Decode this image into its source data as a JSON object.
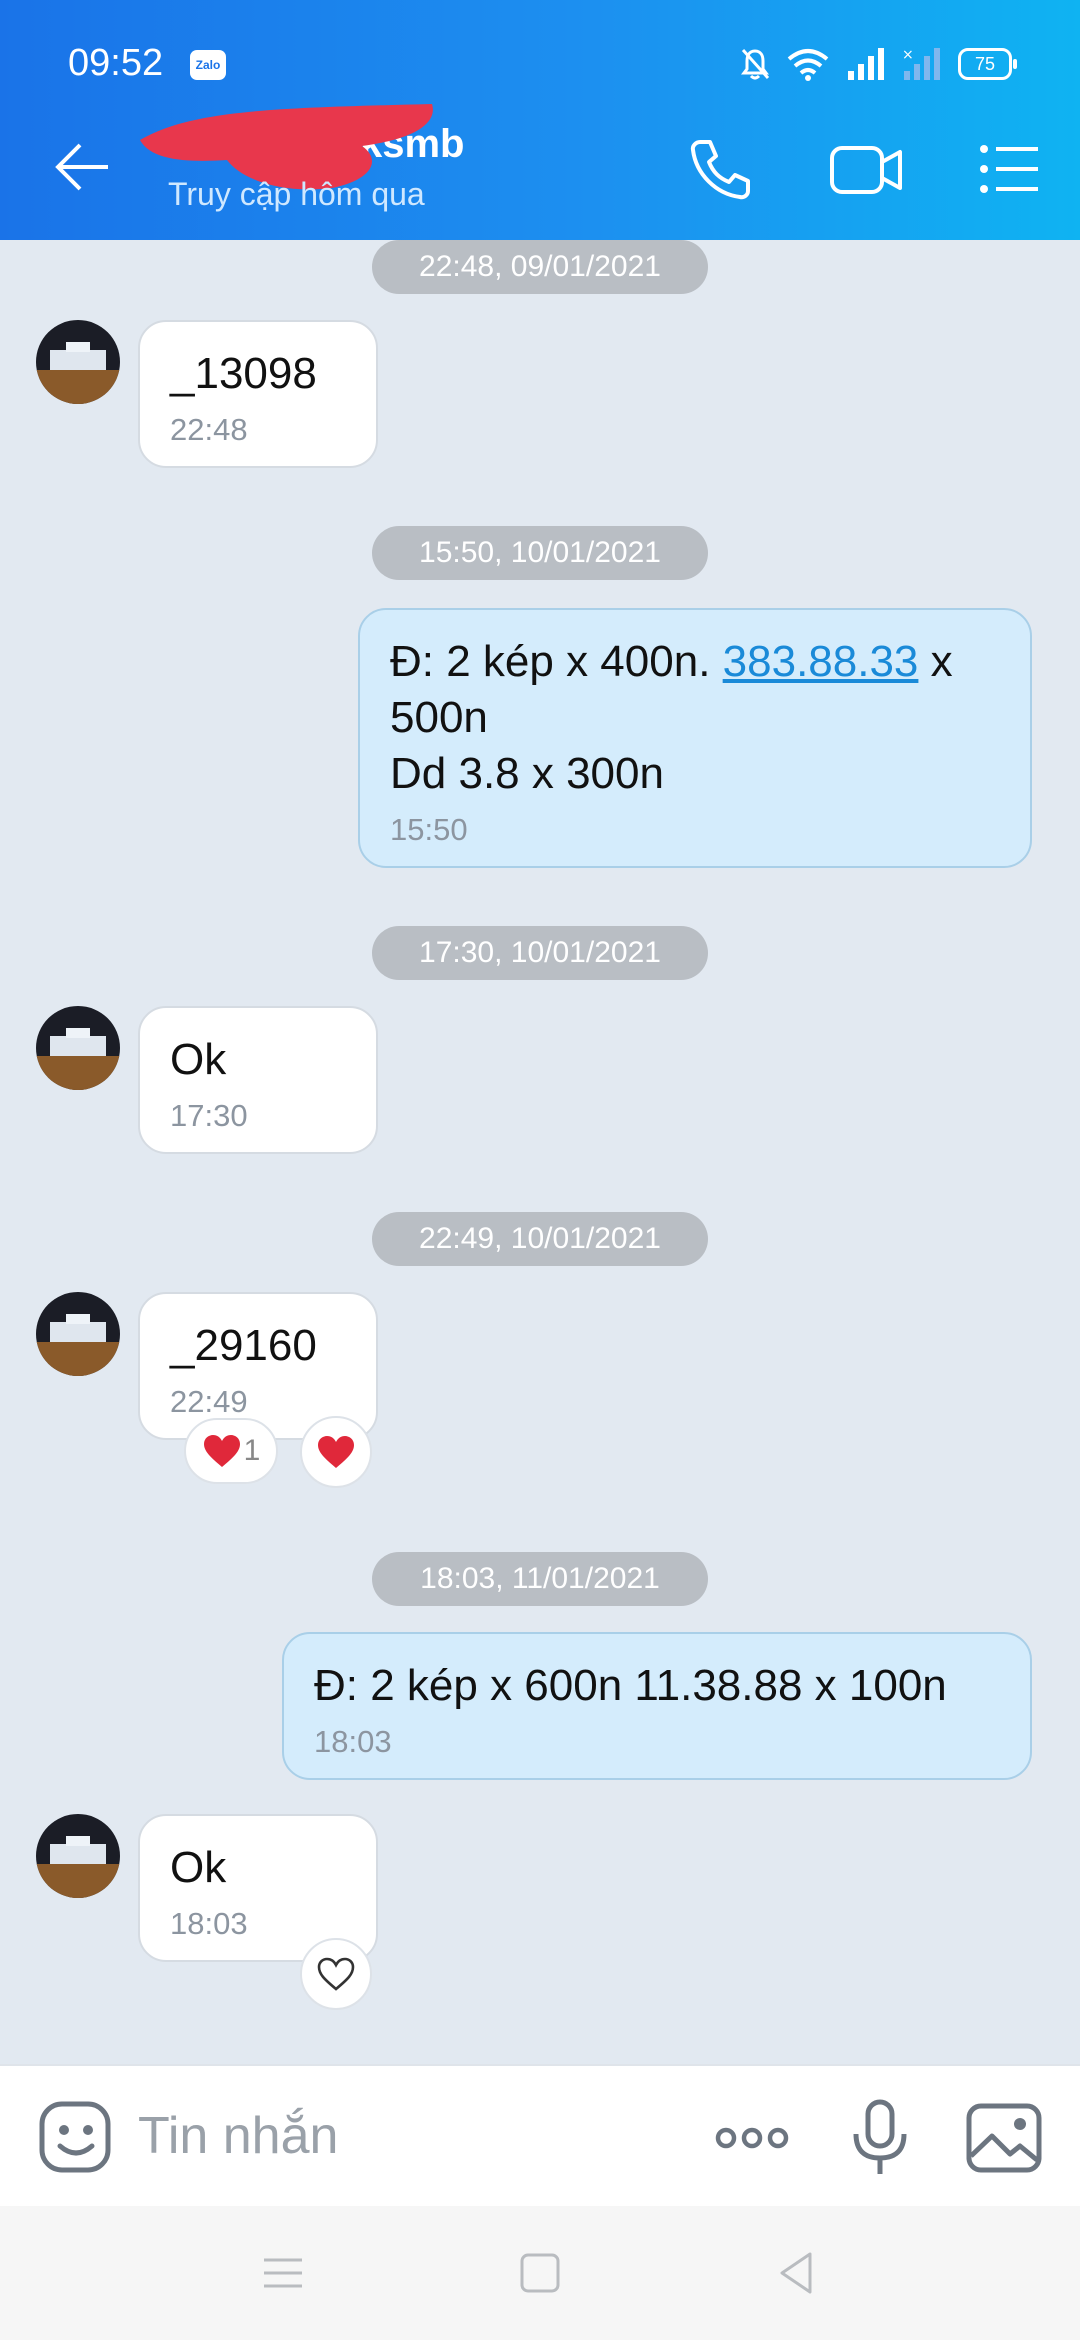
{
  "status": {
    "time": "09:52",
    "app_badge": "Zalo",
    "battery": "75"
  },
  "header": {
    "contact_name": "ksmb",
    "presence": "Truy cập hôm qua"
  },
  "messages": [
    {
      "date": "22:48, 09/01/2021",
      "dir": "in",
      "text": "_13098",
      "time": "22:48"
    },
    {
      "date": "15:50, 10/01/2021",
      "dir": "out",
      "text_before": "Đ: 2 kép x 400n. ",
      "link": "383.88.33",
      "text_after": " x\n500n\nDd 3.8 x 300n",
      "time": "15:50"
    },
    {
      "date": "17:30, 10/01/2021",
      "dir": "in",
      "text": "Ok",
      "time": "17:30"
    },
    {
      "date": "22:49, 10/01/2021",
      "dir": "in",
      "text": "_29160",
      "time": "22:49",
      "reaction_count": "1"
    },
    {
      "date": "18:03, 11/01/2021",
      "dir": "out",
      "text": "Đ: 2 kép x 600n 11.38.88 x 100n",
      "time": "18:03"
    },
    {
      "dir": "in",
      "text": "Ok",
      "time": "18:03"
    }
  ],
  "composer": {
    "placeholder": "Tin nhắn"
  },
  "colors": {
    "header_start": "#1a73e8",
    "header_end": "#0fb3f2",
    "outgoing_bubble": "#d4ecfc",
    "chat_bg": "#e2e9f1",
    "reaction_red": "#e0283a"
  }
}
